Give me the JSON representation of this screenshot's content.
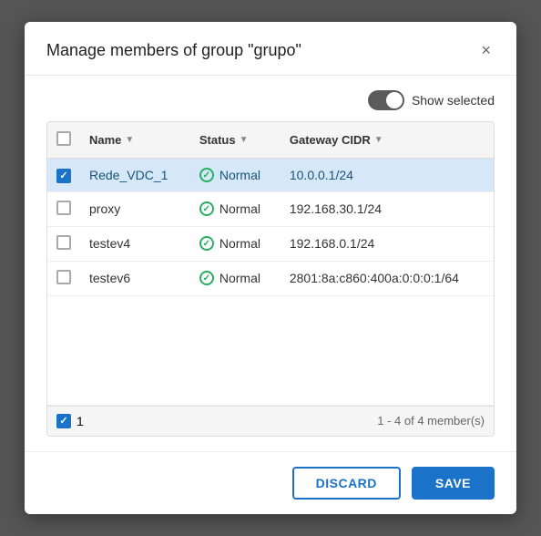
{
  "modal": {
    "title": "Manage members of group \"grupo\"",
    "close_label": "×"
  },
  "toolbar": {
    "show_selected_label": "Show selected",
    "toggle_state": "on"
  },
  "table": {
    "columns": [
      {
        "id": "checkbox",
        "label": ""
      },
      {
        "id": "name",
        "label": "Name"
      },
      {
        "id": "status",
        "label": "Status"
      },
      {
        "id": "gateway_cidr",
        "label": "Gateway CIDR"
      }
    ],
    "rows": [
      {
        "id": 1,
        "name": "Rede_VDC_1",
        "status": "Normal",
        "gateway_cidr": "10.0.0.1/24",
        "selected": true
      },
      {
        "id": 2,
        "name": "proxy",
        "status": "Normal",
        "gateway_cidr": "192.168.30.1/24",
        "selected": false
      },
      {
        "id": 3,
        "name": "testev4",
        "status": "Normal",
        "gateway_cidr": "192.168.0.1/24",
        "selected": false
      },
      {
        "id": 4,
        "name": "testev6",
        "status": "Normal",
        "gateway_cidr": "2801:8a:c860:400a:0:0:0:1/64",
        "selected": false
      }
    ]
  },
  "footer": {
    "selected_count": "1",
    "pagination": "1 - 4 of 4 member(s)"
  },
  "actions": {
    "discard_label": "DISCARD",
    "save_label": "SAVE"
  }
}
